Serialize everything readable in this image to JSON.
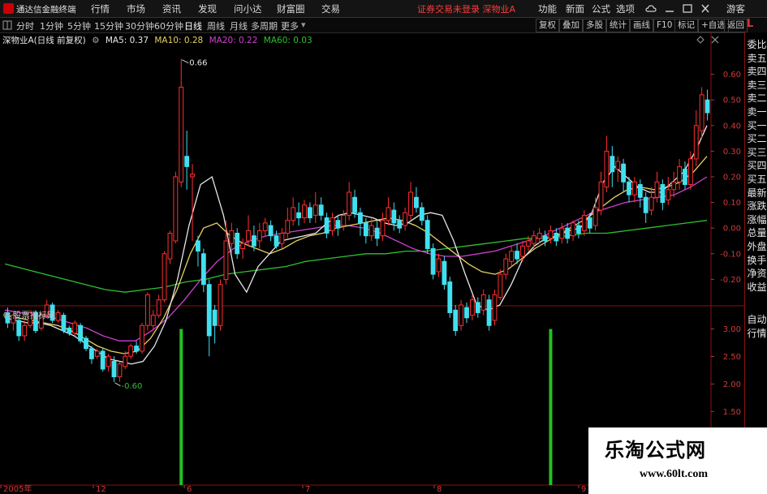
{
  "app": {
    "title": "通达信金融终端",
    "menu": [
      "行情",
      "市场",
      "资讯",
      "发现",
      "问小达",
      "财富圈",
      "交易"
    ],
    "notice": "证券交易未登录  深物业A",
    "right_menu": [
      "功能",
      "新面",
      "公式",
      "选项"
    ],
    "guest": "游客"
  },
  "toolbar": {
    "periods": [
      "分时",
      "1分钟",
      "5分钟",
      "15分钟",
      "30分钟",
      "60分钟",
      "日线",
      "周线",
      "月线",
      "多周期",
      "更多"
    ],
    "active": "日线",
    "buttons": [
      "复权",
      "叠加",
      "多股",
      "统计",
      "画线",
      "F10",
      "标记",
      "+自选",
      "返回"
    ]
  },
  "main_chart": {
    "title": "深物业A(日线 前复权)",
    "ma": [
      {
        "label": "MA5: 0.37",
        "color": "#e8e8e8"
      },
      {
        "label": "MA10: 0.28",
        "color": "#e8d060"
      },
      {
        "label": "MA20: 0.22",
        "color": "#d040d0"
      },
      {
        "label": "MA60: 0.03",
        "color": "#30c030"
      }
    ],
    "high_label": "0.66",
    "low_label": "-0.60"
  },
  "sub_chart": {
    "title": "股票指标网"
  },
  "side_tabs": [
    "委比",
    "卖五",
    "卖四",
    "卖三",
    "卖二",
    "卖一",
    "买一",
    "买二",
    "买三",
    "买四",
    "买五",
    "最新",
    "涨跌",
    "涨幅",
    "总量",
    "外盘",
    "换手",
    "净资",
    "收益"
  ],
  "side_tabs2": [
    "自动",
    "行情"
  ],
  "watermark": {
    "title": "乐淘公式网",
    "url": "www.60lt.com"
  },
  "colors": {
    "up": "#ff3030",
    "down": "#40e0f0",
    "ma5": "#e8e8e8",
    "ma10": "#e8d060",
    "ma20": "#d040d0",
    "ma60": "#30c030",
    "signal": "#22c022"
  },
  "chart_data": {
    "type": "candlestick",
    "ylim": [
      -0.3,
      0.7
    ],
    "y_ticks": [
      "0.60",
      "0.50",
      "0.40",
      "0.30",
      "0.20",
      "0.10",
      "0.00",
      "-0.10",
      "-0.20"
    ],
    "sub_ylim": [
      0,
      3.2
    ],
    "sub_ticks": [
      "3.00",
      "2.50",
      "2.00",
      "1.50",
      "1.00"
    ],
    "x_labels": [
      "2005年",
      "12",
      "6",
      "7",
      "8",
      "9"
    ],
    "candles": [
      [
        -0.33,
        -0.37,
        -0.31,
        -0.39
      ],
      [
        -0.37,
        -0.34,
        -0.33,
        -0.4
      ],
      [
        -0.36,
        -0.42,
        -0.35,
        -0.44
      ],
      [
        -0.42,
        -0.38,
        -0.36,
        -0.44
      ],
      [
        -0.38,
        -0.33,
        -0.32,
        -0.39
      ],
      [
        -0.33,
        -0.4,
        -0.32,
        -0.41
      ],
      [
        -0.39,
        -0.34,
        -0.33,
        -0.4
      ],
      [
        -0.34,
        -0.3,
        -0.28,
        -0.35
      ],
      [
        -0.3,
        -0.36,
        -0.29,
        -0.37
      ],
      [
        -0.36,
        -0.33,
        -0.32,
        -0.37
      ],
      [
        -0.34,
        -0.4,
        -0.33,
        -0.41
      ],
      [
        -0.39,
        -0.41,
        -0.38,
        -0.42
      ],
      [
        -0.41,
        -0.37,
        -0.36,
        -0.42
      ],
      [
        -0.38,
        -0.44,
        -0.37,
        -0.45
      ],
      [
        -0.43,
        -0.47,
        -0.42,
        -0.48
      ],
      [
        -0.47,
        -0.51,
        -0.46,
        -0.53
      ],
      [
        -0.5,
        -0.48,
        -0.47,
        -0.51
      ],
      [
        -0.48,
        -0.55,
        -0.47,
        -0.56
      ],
      [
        -0.54,
        -0.5,
        -0.49,
        -0.56
      ],
      [
        -0.52,
        -0.58,
        -0.5,
        -0.6
      ],
      [
        -0.58,
        -0.53,
        -0.52,
        -0.6
      ],
      [
        -0.54,
        -0.5,
        -0.48,
        -0.55
      ],
      [
        -0.5,
        -0.46,
        -0.45,
        -0.51
      ],
      [
        -0.46,
        -0.48,
        -0.44,
        -0.49
      ],
      [
        -0.48,
        -0.38,
        -0.37,
        -0.49
      ],
      [
        -0.38,
        -0.26,
        -0.25,
        -0.4
      ],
      [
        -0.38,
        -0.34,
        -0.32,
        -0.4
      ],
      [
        -0.34,
        -0.28,
        -0.26,
        -0.35
      ],
      [
        -0.28,
        -0.1,
        -0.09,
        -0.29
      ],
      [
        -0.12,
        -0.02,
        -0.01,
        -0.14
      ],
      [
        -0.05,
        0.2,
        0.22,
        -0.06
      ],
      [
        0.18,
        0.55,
        0.66,
        0.16
      ],
      [
        0.28,
        0.24,
        0.38,
        0.15
      ],
      [
        0.2,
        0.21,
        0.25,
        -0.05
      ],
      [
        -0.05,
        -0.09,
        -0.03,
        -0.15
      ],
      [
        -0.1,
        -0.22,
        -0.08,
        -0.25
      ],
      [
        -0.22,
        -0.42,
        -0.2,
        -0.5
      ],
      [
        -0.32,
        -0.38,
        -0.3,
        -0.45
      ],
      [
        -0.38,
        -0.22,
        -0.2,
        -0.4
      ],
      [
        -0.2,
        -0.05,
        0.03,
        -0.22
      ],
      [
        -0.06,
        -0.01,
        0.02,
        -0.1
      ],
      [
        -0.02,
        -0.1,
        0.0,
        -0.12
      ],
      [
        -0.08,
        -0.06,
        -0.04,
        -0.12
      ],
      [
        -0.05,
        -0.01,
        0.05,
        -0.07
      ],
      [
        -0.03,
        -0.07,
        0.01,
        -0.09
      ],
      [
        -0.05,
        -0.01,
        0.02,
        -0.08
      ],
      [
        -0.01,
        0.02,
        0.04,
        -0.03
      ],
      [
        0.01,
        -0.03,
        0.03,
        -0.05
      ],
      [
        -0.03,
        -0.07,
        -0.01,
        -0.08
      ],
      [
        -0.06,
        -0.02,
        0.0,
        -0.08
      ],
      [
        -0.02,
        0.03,
        0.08,
        -0.04
      ],
      [
        0.03,
        0.08,
        0.12,
        0.01
      ],
      [
        0.06,
        0.04,
        0.1,
        0.01
      ],
      [
        0.04,
        0.09,
        0.11,
        0.02
      ],
      [
        0.08,
        0.04,
        0.1,
        0.02
      ],
      [
        0.05,
        0.09,
        0.14,
        0.02
      ],
      [
        0.09,
        0.05,
        0.12,
        0.03
      ],
      [
        0.04,
        -0.02,
        0.06,
        -0.04
      ],
      [
        -0.01,
        0.04,
        0.06,
        -0.03
      ],
      [
        0.03,
        0.0,
        0.05,
        -0.03
      ],
      [
        0.01,
        0.05,
        0.07,
        -0.01
      ],
      [
        0.05,
        0.14,
        0.18,
        0.03
      ],
      [
        0.12,
        0.06,
        0.15,
        0.04
      ],
      [
        0.06,
        0.02,
        0.08,
        -0.03
      ],
      [
        0.02,
        -0.03,
        0.04,
        -0.06
      ],
      [
        -0.03,
        0.01,
        0.04,
        -0.05
      ],
      [
        0.0,
        -0.04,
        0.03,
        -0.07
      ],
      [
        -0.03,
        0.03,
        0.06,
        -0.05
      ],
      [
        0.03,
        0.08,
        0.12,
        0.01
      ],
      [
        0.07,
        0.02,
        0.1,
        -0.01
      ],
      [
        0.03,
        0.0,
        0.05,
        -0.02
      ],
      [
        0.01,
        0.06,
        0.08,
        -0.01
      ],
      [
        0.05,
        0.14,
        0.18,
        0.03
      ],
      [
        0.12,
        0.08,
        0.16,
        0.06
      ],
      [
        0.08,
        0.03,
        0.1,
        0.01
      ],
      [
        0.03,
        -0.08,
        0.05,
        -0.1
      ],
      [
        -0.08,
        -0.18,
        -0.06,
        -0.2
      ],
      [
        -0.17,
        -0.12,
        -0.1,
        -0.19
      ],
      [
        -0.13,
        -0.22,
        -0.11,
        -0.24
      ],
      [
        -0.21,
        -0.33,
        -0.19,
        -0.35
      ],
      [
        -0.32,
        -0.4,
        -0.3,
        -0.42
      ],
      [
        -0.38,
        -0.3,
        -0.28,
        -0.4
      ],
      [
        -0.31,
        -0.35,
        -0.29,
        -0.37
      ],
      [
        -0.34,
        -0.28,
        -0.26,
        -0.36
      ],
      [
        -0.29,
        -0.33,
        -0.27,
        -0.35
      ],
      [
        -0.32,
        -0.26,
        -0.24,
        -0.34
      ],
      [
        -0.28,
        -0.38,
        -0.26,
        -0.4
      ],
      [
        -0.36,
        -0.26,
        -0.24,
        -0.38
      ],
      [
        -0.27,
        -0.18,
        -0.16,
        -0.28
      ],
      [
        -0.18,
        -0.12,
        -0.1,
        -0.2
      ],
      [
        -0.13,
        -0.09,
        -0.07,
        -0.15
      ],
      [
        -0.09,
        -0.12,
        -0.06,
        -0.14
      ],
      [
        -0.11,
        -0.07,
        -0.05,
        -0.13
      ],
      [
        -0.07,
        -0.05,
        -0.03,
        -0.09
      ],
      [
        -0.06,
        -0.03,
        -0.01,
        -0.08
      ],
      [
        -0.04,
        -0.02,
        0.0,
        -0.06
      ],
      [
        -0.03,
        -0.05,
        -0.01,
        -0.07
      ],
      [
        -0.04,
        -0.01,
        0.01,
        -0.06
      ],
      [
        -0.02,
        -0.05,
        0.0,
        -0.07
      ],
      [
        -0.04,
        0.0,
        0.02,
        -0.06
      ],
      [
        0.0,
        -0.04,
        0.02,
        -0.06
      ],
      [
        -0.03,
        0.02,
        0.03,
        -0.05
      ],
      [
        0.01,
        -0.02,
        0.03,
        -0.04
      ],
      [
        -0.01,
        0.05,
        0.07,
        -0.03
      ],
      [
        0.04,
        0.0,
        0.06,
        -0.02
      ],
      [
        0.01,
        0.08,
        0.12,
        -0.01
      ],
      [
        0.07,
        0.18,
        0.22,
        0.05
      ],
      [
        0.16,
        0.3,
        0.36,
        0.14
      ],
      [
        0.28,
        0.22,
        0.32,
        0.16
      ],
      [
        0.23,
        0.26,
        0.28,
        0.18
      ],
      [
        0.25,
        0.18,
        0.27,
        0.14
      ],
      [
        0.18,
        0.13,
        0.2,
        0.1
      ],
      [
        0.13,
        0.18,
        0.2,
        0.1
      ],
      [
        0.17,
        0.12,
        0.19,
        0.08
      ],
      [
        0.12,
        0.06,
        0.14,
        0.02
      ],
      [
        0.07,
        0.12,
        0.16,
        0.05
      ],
      [
        0.12,
        0.18,
        0.22,
        0.1
      ],
      [
        0.17,
        0.1,
        0.19,
        0.07
      ],
      [
        0.11,
        0.15,
        0.2,
        0.09
      ],
      [
        0.15,
        0.18,
        0.22,
        0.12
      ],
      [
        0.18,
        0.24,
        0.27,
        0.15
      ],
      [
        0.23,
        0.17,
        0.26,
        0.15
      ],
      [
        0.17,
        0.27,
        0.3,
        0.15
      ],
      [
        0.27,
        0.4,
        0.46,
        0.24
      ],
      [
        0.38,
        0.52,
        0.55,
        0.35
      ],
      [
        0.5,
        0.45,
        0.54,
        0.42
      ]
    ],
    "ma5": [
      -0.35,
      -0.36,
      -0.37,
      -0.37,
      -0.38,
      -0.4,
      -0.42,
      -0.45,
      -0.48,
      -0.51,
      -0.52,
      -0.53,
      -0.52,
      -0.46,
      -0.36,
      -0.2,
      0.01,
      0.17,
      0.2,
      0.05,
      -0.18,
      -0.25,
      -0.15,
      -0.1,
      -0.05,
      -0.04,
      -0.03,
      -0.02,
      0.02,
      0.05,
      0.06,
      0.05,
      0.04,
      0.02,
      0.01,
      0.02,
      0.05,
      0.06,
      0.05,
      -0.05,
      -0.18,
      -0.3,
      -0.32,
      -0.3,
      -0.22,
      -0.12,
      -0.07,
      -0.04,
      -0.03,
      -0.01,
      0.0,
      0.06,
      0.18,
      0.24,
      0.2,
      0.16,
      0.14,
      0.14,
      0.18,
      0.22,
      0.3,
      0.4
    ],
    "ma10": [
      -0.34,
      -0.35,
      -0.36,
      -0.37,
      -0.38,
      -0.4,
      -0.43,
      -0.46,
      -0.48,
      -0.49,
      -0.48,
      -0.43,
      -0.35,
      -0.24,
      -0.1,
      0.0,
      0.02,
      -0.03,
      -0.06,
      -0.08,
      -0.1,
      -0.08,
      -0.05,
      -0.03,
      -0.02,
      0.0,
      0.01,
      0.02,
      0.03,
      0.04,
      0.03,
      0.01,
      -0.02,
      -0.06,
      -0.1,
      -0.14,
      -0.17,
      -0.18,
      -0.16,
      -0.12,
      -0.08,
      -0.05,
      -0.02,
      0.01,
      0.04,
      0.08,
      0.12,
      0.15,
      0.16,
      0.15,
      0.16,
      0.18,
      0.22,
      0.28
    ],
    "ma20": [
      -0.32,
      -0.33,
      -0.34,
      -0.35,
      -0.37,
      -0.39,
      -0.42,
      -0.44,
      -0.44,
      -0.4,
      -0.35,
      -0.28,
      -0.2,
      -0.13,
      -0.08,
      -0.05,
      -0.03,
      -0.02,
      -0.01,
      0.0,
      0.01,
      0.01,
      0.0,
      -0.02,
      -0.05,
      -0.08,
      -0.1,
      -0.11,
      -0.11,
      -0.1,
      -0.09,
      -0.07,
      -0.05,
      -0.03,
      0.0,
      0.03,
      0.06,
      0.08,
      0.1,
      0.11,
      0.12,
      0.13,
      0.16,
      0.2
    ],
    "ma60": [
      -0.14,
      -0.16,
      -0.18,
      -0.2,
      -0.22,
      -0.24,
      -0.25,
      -0.24,
      -0.23,
      -0.21,
      -0.2,
      -0.18,
      -0.17,
      -0.16,
      -0.15,
      -0.13,
      -0.12,
      -0.11,
      -0.1,
      -0.1,
      -0.09,
      -0.09,
      -0.08,
      -0.07,
      -0.06,
      -0.05,
      -0.04,
      -0.04,
      -0.03,
      -0.02,
      -0.02,
      -0.01,
      0.0,
      0.01,
      0.02,
      0.03
    ],
    "signals": [
      {
        "index": 31,
        "value": 3.0
      },
      {
        "index": 97,
        "value": 3.0
      }
    ]
  }
}
